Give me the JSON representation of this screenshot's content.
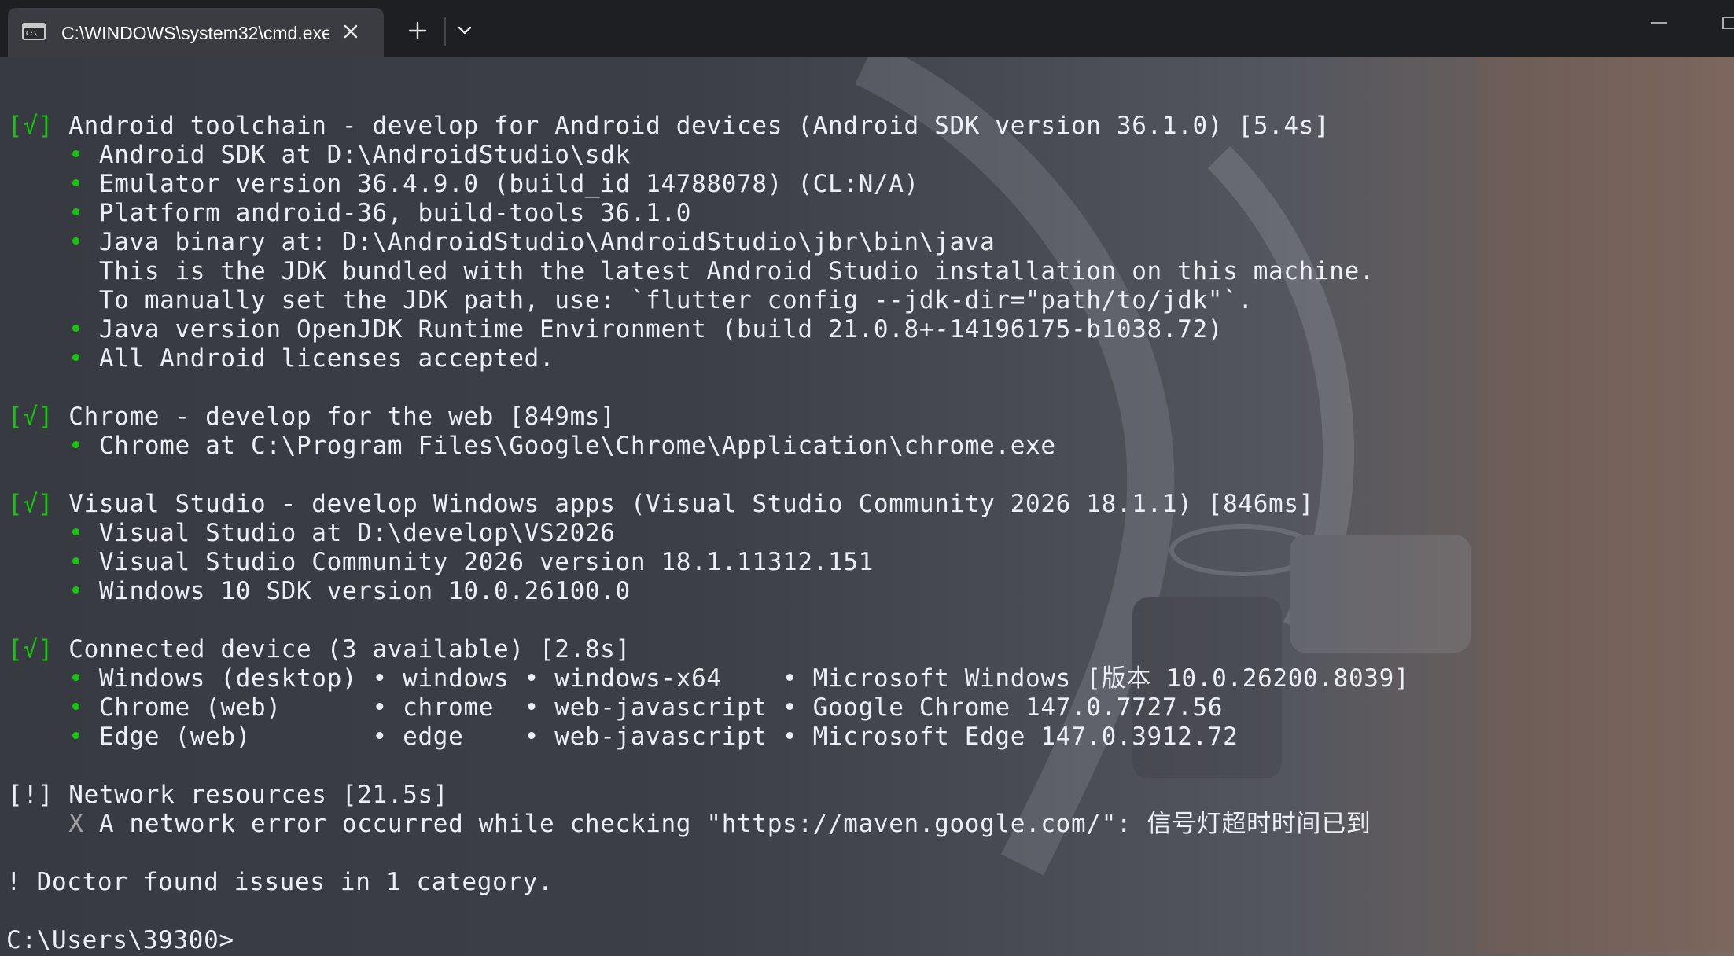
{
  "tab": {
    "title": "C:\\WINDOWS\\system32\\cmd.exe",
    "icon": "terminal-icon",
    "close_icon": "close-icon",
    "new_tab_icon": "plus-icon",
    "dropdown_icon": "chevron-down-icon"
  },
  "window_controls": {
    "minimize_icon": "minimize-icon",
    "maximize_icon": "maximize-icon"
  },
  "colors": {
    "check_green": "#16c60c",
    "text": "#eceff4",
    "titlebar": "#1e1f22",
    "tab_bg": "#3a3c42"
  },
  "output": {
    "l0": {
      "mark": "[√]",
      "text": " Android toolchain - develop for Android devices (Android SDK version 36.1.0) [5.4s]"
    },
    "l1": {
      "bullet": "    •",
      "text": " Android SDK at D:\\AndroidStudio\\sdk"
    },
    "l2": {
      "bullet": "    •",
      "text": " Emulator version 36.4.9.0 (build_id 14788078) (CL:N/A)"
    },
    "l3": {
      "bullet": "    •",
      "text": " Platform android-36, build-tools 36.1.0"
    },
    "l4": {
      "bullet": "    •",
      "text": " Java binary at: D:\\AndroidStudio\\AndroidStudio\\jbr\\bin\\java"
    },
    "l5": {
      "text": "      This is the JDK bundled with the latest Android Studio installation on this machine."
    },
    "l6": {
      "text": "      To manually set the JDK path, use: `flutter config --jdk-dir=\"path/to/jdk\"`."
    },
    "l7": {
      "bullet": "    •",
      "text": " Java version OpenJDK Runtime Environment (build 21.0.8+-14196175-b1038.72)"
    },
    "l8": {
      "bullet": "    •",
      "text": " All Android licenses accepted."
    },
    "l9": {
      "mark": "[√]",
      "text": " Chrome - develop for the web [849ms]"
    },
    "l10": {
      "bullet": "    •",
      "text": " Chrome at C:\\Program Files\\Google\\Chrome\\Application\\chrome.exe"
    },
    "l11": {
      "mark": "[√]",
      "text": " Visual Studio - develop Windows apps (Visual Studio Community 2026 18.1.1) [846ms]"
    },
    "l12": {
      "bullet": "    •",
      "text": " Visual Studio at D:\\develop\\VS2026"
    },
    "l13": {
      "bullet": "    •",
      "text": " Visual Studio Community 2026 version 18.1.11312.151"
    },
    "l14": {
      "bullet": "    •",
      "text": " Windows 10 SDK version 10.0.26100.0"
    },
    "l15": {
      "mark": "[√]",
      "text": " Connected device (3 available) [2.8s]"
    },
    "l16": {
      "bullet": "    •",
      "text": " Windows (desktop) • windows • windows-x64    • Microsoft Windows [版本 10.0.26200.8039]"
    },
    "l17": {
      "bullet": "    •",
      "text": " Chrome (web)      • chrome  • web-javascript • Google Chrome 147.0.7727.56"
    },
    "l18": {
      "bullet": "    •",
      "text": " Edge (web)        • edge    • web-javascript • Microsoft Edge 147.0.3912.72"
    },
    "l19": {
      "mark": "[!]",
      "text": " Network resources [21.5s]"
    },
    "l20": {
      "bullet": "    X",
      "text": " A network error occurred while checking \"https://maven.google.com/\": 信号灯超时时间已到"
    },
    "l21": {
      "text": "! Doctor found issues in 1 category."
    },
    "l22": {
      "text": "C:\\Users\\39300>"
    }
  }
}
